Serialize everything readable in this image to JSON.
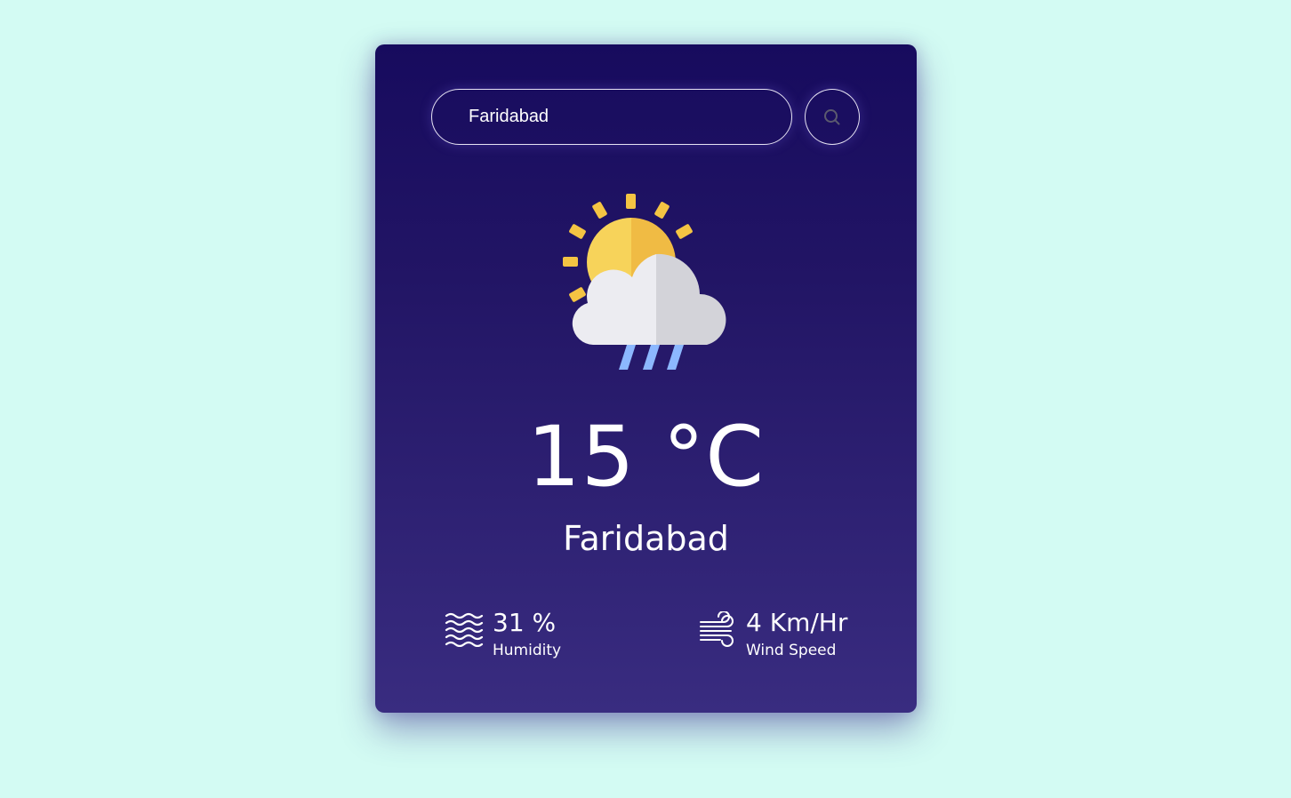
{
  "search": {
    "value": "Faridabad",
    "button_icon": "search-icon"
  },
  "weather": {
    "icon": "partly-cloudy-rain-icon",
    "temperature": "15 °C",
    "city": "Faridabad"
  },
  "humidity": {
    "icon": "humidity-waves-icon",
    "value": "31 %",
    "label": "Humidity"
  },
  "wind": {
    "icon": "wind-icon",
    "value": "4 Km/Hr",
    "label": "Wind Speed"
  },
  "colors": {
    "page_background": "#d3fbf3",
    "card_top": "#170b5e",
    "card_bottom": "#392c80",
    "sun": "#f7d358",
    "cloud": "#ebebef",
    "rain": "#7fb0ff"
  }
}
